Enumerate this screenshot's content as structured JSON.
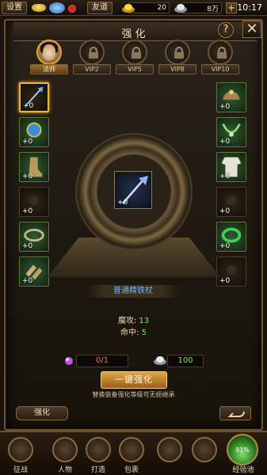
{
  "topbar": {
    "settings_label": "设置",
    "friends_label": "友道",
    "gold_value": "20",
    "silver_value": "8万",
    "plus_label": "+",
    "time": "10:17"
  },
  "panel": {
    "title": "强化",
    "help_label": "?",
    "close_label": "✕"
  },
  "tabs": [
    {
      "label": "法师"
    },
    {
      "label": "VIP2"
    },
    {
      "label": "VIP5"
    },
    {
      "label": "VIP8"
    },
    {
      "label": "VIP10"
    }
  ],
  "left_slots": [
    {
      "count": "+0",
      "icon": "staff-icon"
    },
    {
      "count": "+0",
      "icon": "orb-bracelet-icon"
    },
    {
      "count": "+0",
      "icon": "boot-icon"
    },
    {
      "count": "+0",
      "icon": "empty-slot-icon"
    },
    {
      "count": "+0",
      "icon": "belt-icon"
    },
    {
      "count": "+0",
      "icon": "sandal-icon"
    }
  ],
  "right_slots": [
    {
      "count": "+0",
      "icon": "helmet-icon"
    },
    {
      "count": "+0",
      "icon": "necklace-icon"
    },
    {
      "count": "+0",
      "icon": "robe-icon"
    },
    {
      "count": "+0",
      "icon": "empty-slot-icon"
    },
    {
      "count": "+0",
      "icon": "jade-ring-icon"
    },
    {
      "count": "+0",
      "icon": "empty-slot-icon"
    }
  ],
  "center": {
    "count": "+0",
    "item_name": "普通精铁杖"
  },
  "stats": [
    {
      "label": "魔攻:",
      "value": "13"
    },
    {
      "label": "命中:",
      "value": "5"
    }
  ],
  "costs": {
    "gem_value": "0/1",
    "silver_value": "100"
  },
  "actions": {
    "one_click_label": "一键强化",
    "hint": "替换装备强化等级可无损继承",
    "bottom_tab_label": "强化"
  },
  "nav": [
    {
      "label": "征战"
    },
    {
      "label": "人物"
    },
    {
      "label": "打造"
    },
    {
      "label": "包裹"
    },
    {
      "label": ""
    },
    {
      "label": ""
    },
    {
      "label": "经验池"
    }
  ],
  "exp_orb_value": "91%",
  "colors": {
    "accent": "#f3b43a",
    "stat_value": "#7fe36b",
    "item_name": "#6fb6ff",
    "cost_red": "#ff6b6b"
  }
}
